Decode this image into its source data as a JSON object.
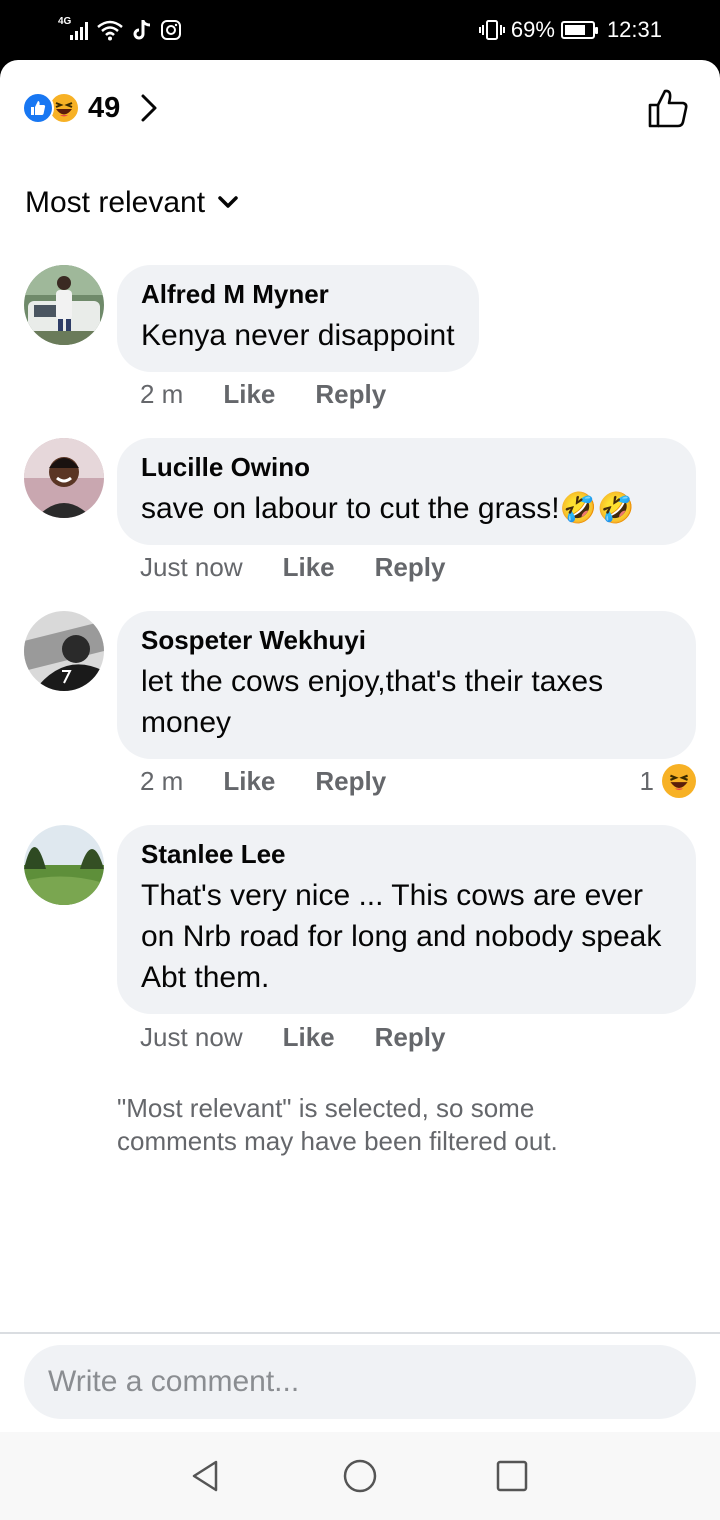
{
  "status_bar": {
    "network": "4G",
    "battery": "69%",
    "time": "12:31",
    "icons": [
      "signal-icon",
      "wifi-icon",
      "tiktok-icon",
      "instagram-icon",
      "vibrate-icon",
      "battery-icon"
    ]
  },
  "header": {
    "reaction_count": "49",
    "reactions": [
      "like",
      "haha"
    ]
  },
  "sort": {
    "label": "Most relevant"
  },
  "comments": [
    {
      "author": "Alfred M Myner",
      "text": "Kenya never disappoint",
      "time": "2 m",
      "like": "Like",
      "reply": "Reply"
    },
    {
      "author": "Lucille Owino",
      "text": "save on labour to cut the grass!",
      "emoji": "🤣🤣",
      "time": "Just now",
      "like": "Like",
      "reply": "Reply"
    },
    {
      "author": "Sospeter Wekhuyi",
      "text": "let the cows enjoy,that's their taxes money",
      "time": "2 m",
      "like": "Like",
      "reply": "Reply",
      "reaction_count": "1"
    },
    {
      "author": "Stanlee Lee",
      "text": "That's very nice ... This cows are ever on Nrb road for long and nobody speak Abt them.",
      "time": "Just now",
      "like": "Like",
      "reply": "Reply"
    }
  ],
  "filter_note": "\"Most relevant\" is selected, so some comments may have been filtered out.",
  "composer": {
    "placeholder": "Write a comment..."
  },
  "colors": {
    "accent": "#1877f2",
    "haha": "#f7b125",
    "bubble": "#f0f2f5",
    "meta": "#65676b"
  }
}
